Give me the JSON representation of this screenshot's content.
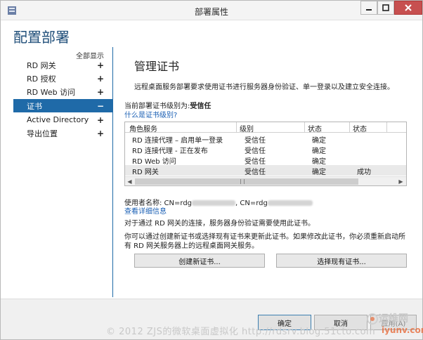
{
  "window": {
    "title": "部署属性",
    "controls": {
      "minimize_icon": "minimize-icon",
      "maximize_icon": "maximize-icon",
      "close_icon": "close-icon"
    }
  },
  "page": {
    "heading": "配置部署"
  },
  "sidebar": {
    "show_all": "全部显示",
    "items": [
      {
        "label": "RD 网关",
        "toggle": "+",
        "selected": false
      },
      {
        "label": "RD 授权",
        "toggle": "+",
        "selected": false
      },
      {
        "label": "RD Web 访问",
        "toggle": "+",
        "selected": false
      },
      {
        "label": "证书",
        "toggle": "−",
        "selected": true
      },
      {
        "label": "Active Directory",
        "toggle": "+",
        "selected": false
      },
      {
        "label": "导出位置",
        "toggle": "+",
        "selected": false
      }
    ]
  },
  "certificates": {
    "title": "管理证书",
    "description": "远程桌面服务部署要求使用证书进行服务器身份验证、单一登录以及建立安全连接。",
    "level_prefix": "当前部署证书级别为:",
    "level_value": "受信任",
    "level_link": "什么是证书级别?",
    "grid": {
      "columns": [
        "角色服务",
        "级别",
        "状态",
        "状态"
      ],
      "rows": [
        {
          "role": "RD 连接代理 – 启用单一登录",
          "level": "受信任",
          "status": "确定",
          "status2": ""
        },
        {
          "role": "RD 连接代理 - 正在发布",
          "level": "受信任",
          "status": "确定",
          "status2": ""
        },
        {
          "role": "RD Web 访问",
          "level": "受信任",
          "status": "确定",
          "status2": ""
        },
        {
          "role": "RD 网关",
          "level": "受信任",
          "status": "确定",
          "status2": "成功"
        }
      ]
    },
    "issued_prefix": "使用者名称: CN=rdg",
    "issued_mid": ", CN=rdg",
    "detail_link": "查看详细信息",
    "note1": "对于通过 RD 网关的连接，服务器身份验证需要使用此证书。",
    "note2": "你可以通过创建新证书或选择现有证书来更新此证书。如果修改此证书，你必须重新启动所有 RD 网关服务器上的远程桌面网关服务。",
    "create_button": "创建新证书...",
    "select_button": "选择现有证书..."
  },
  "footer": {
    "ok": "确定",
    "cancel": "取消",
    "apply": "应用(A)"
  },
  "watermark": {
    "text": "© 2012 ZJS的微软桌面虚拟化 http://rdsrv.blog.51cto.com",
    "logo_main": "运维网",
    "logo_sub": "iyunv.com"
  }
}
